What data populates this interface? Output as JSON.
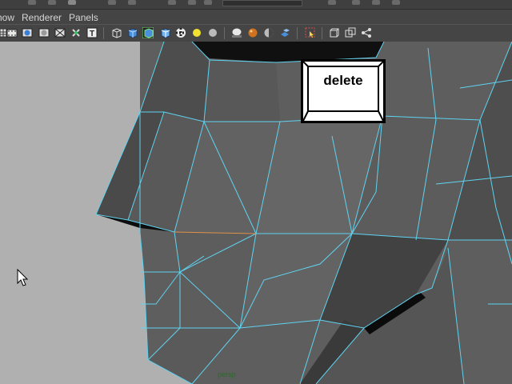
{
  "menubar": {
    "items": [
      "how",
      "Renderer",
      "Panels"
    ]
  },
  "toolbar": {
    "icons": [
      "grid-icon",
      "film-gate-icon",
      "resolution-gate-icon",
      "safe-area-icon",
      "camera-attr-icon",
      "xray-icon",
      "text-icon",
      "wireframe-cube-icon",
      "smooth-shade-icon",
      "wireframe-on-shaded-icon",
      "textured-icon",
      "checker-icon",
      "use-lights-icon",
      "shadows-icon",
      "default-material-icon",
      "xray-joints-icon",
      "backface-icon",
      "isolate-select-icon",
      "select-cage-icon",
      "frame-icon",
      "share-icon"
    ]
  },
  "viewport": {
    "camera_label": "persp"
  },
  "callout": {
    "label": "delete"
  },
  "colors": {
    "wire": "#5fd3f0",
    "background": "#b0b0b0",
    "edge_highlight": "#e0904a"
  }
}
